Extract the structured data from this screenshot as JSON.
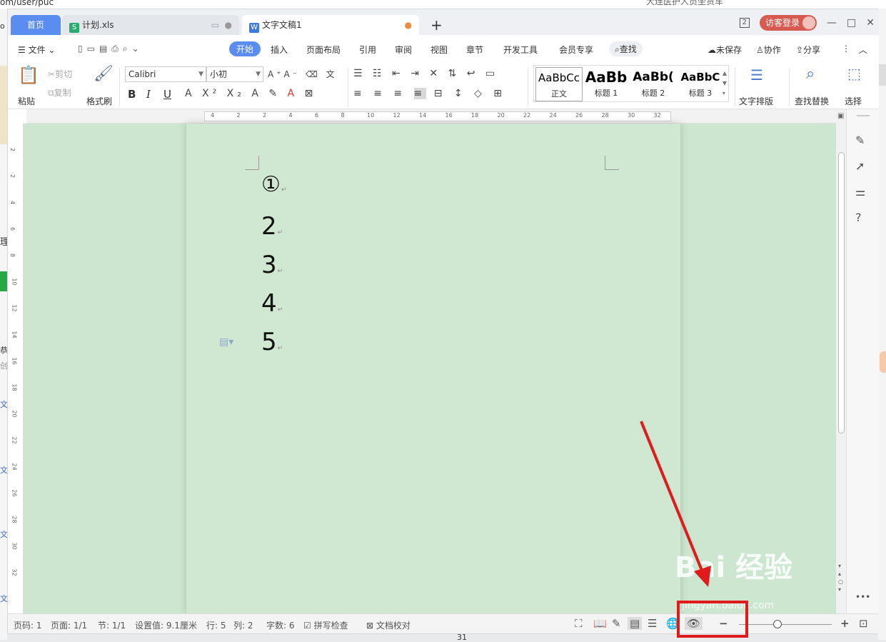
{
  "browser": {
    "url_fragment": "om/user/puc",
    "bookmark_text": "大连医护人员坐货车",
    "left_fragments": [
      "o",
      "理",
      "恭",
      "创",
      "文",
      "文",
      "文",
      "文"
    ]
  },
  "tabs": {
    "home": "首页",
    "xls": "计划.xls",
    "doc": "文字文稿1",
    "new_tab": "+"
  },
  "window": {
    "count_badge": "2",
    "visitor_login": "访客登录",
    "minimize": "—",
    "maximize": "□",
    "close": "✕"
  },
  "menu": {
    "file": "文件",
    "tabs": [
      "开始",
      "插入",
      "页面布局",
      "引用",
      "审阅",
      "视图",
      "章节",
      "开发工具",
      "会员专享"
    ],
    "find": "查找",
    "unsaved": "未保存",
    "collaborate": "协作",
    "share": "分享"
  },
  "ribbon": {
    "paste": "粘贴",
    "cut": "剪切",
    "copy": "复制",
    "format_painter": "格式刷",
    "font_name": "Calibri",
    "font_size": "小初",
    "bold": "B",
    "italic": "I",
    "underline": "U",
    "styles": [
      {
        "sample": "AaBbCc",
        "label": "正文"
      },
      {
        "sample": "AaBb",
        "label": "标题 1"
      },
      {
        "sample": "AaBb(",
        "label": "标题 2"
      },
      {
        "sample": "AaBbC",
        "label": "标题 3"
      }
    ],
    "text_layout": "文字排版",
    "find_replace": "查找替换",
    "select": "选择"
  },
  "ruler": {
    "h_ticks": [
      "4",
      "2",
      "2",
      "4",
      "6",
      "8",
      "10",
      "12",
      "14",
      "16",
      "18",
      "20",
      "22",
      "24",
      "26",
      "28",
      "30",
      "32"
    ],
    "v_ticks": [
      "2",
      "2",
      "4",
      "6",
      "8",
      "10",
      "12",
      "14",
      "16",
      "18",
      "20",
      "22",
      "24",
      "26",
      "28",
      "30",
      "32"
    ]
  },
  "document": {
    "lines": [
      "①",
      "2",
      "3",
      "4",
      "5"
    ],
    "paragraph_mark": "↵"
  },
  "status": {
    "page_code": "页码: 1",
    "pages": "页面: 1/1",
    "section": "节: 1/1",
    "setting": "设置值: 9.1厘米",
    "row": "行: 5",
    "col": "列: 2",
    "word_count": "字数: 6",
    "spell_check": "拼写检查",
    "doc_proof": "文档校对",
    "zoom_minus": "−",
    "zoom_plus": "+"
  },
  "watermark": {
    "brand": "Bai 经验",
    "url": "jingyan.baidu.com"
  },
  "bottom_number": "31",
  "colors": {
    "accent": "#5b8df0",
    "doc_bg": "#cce6cf",
    "highlight": "#e01b1b",
    "visitor": "#d85b52"
  }
}
